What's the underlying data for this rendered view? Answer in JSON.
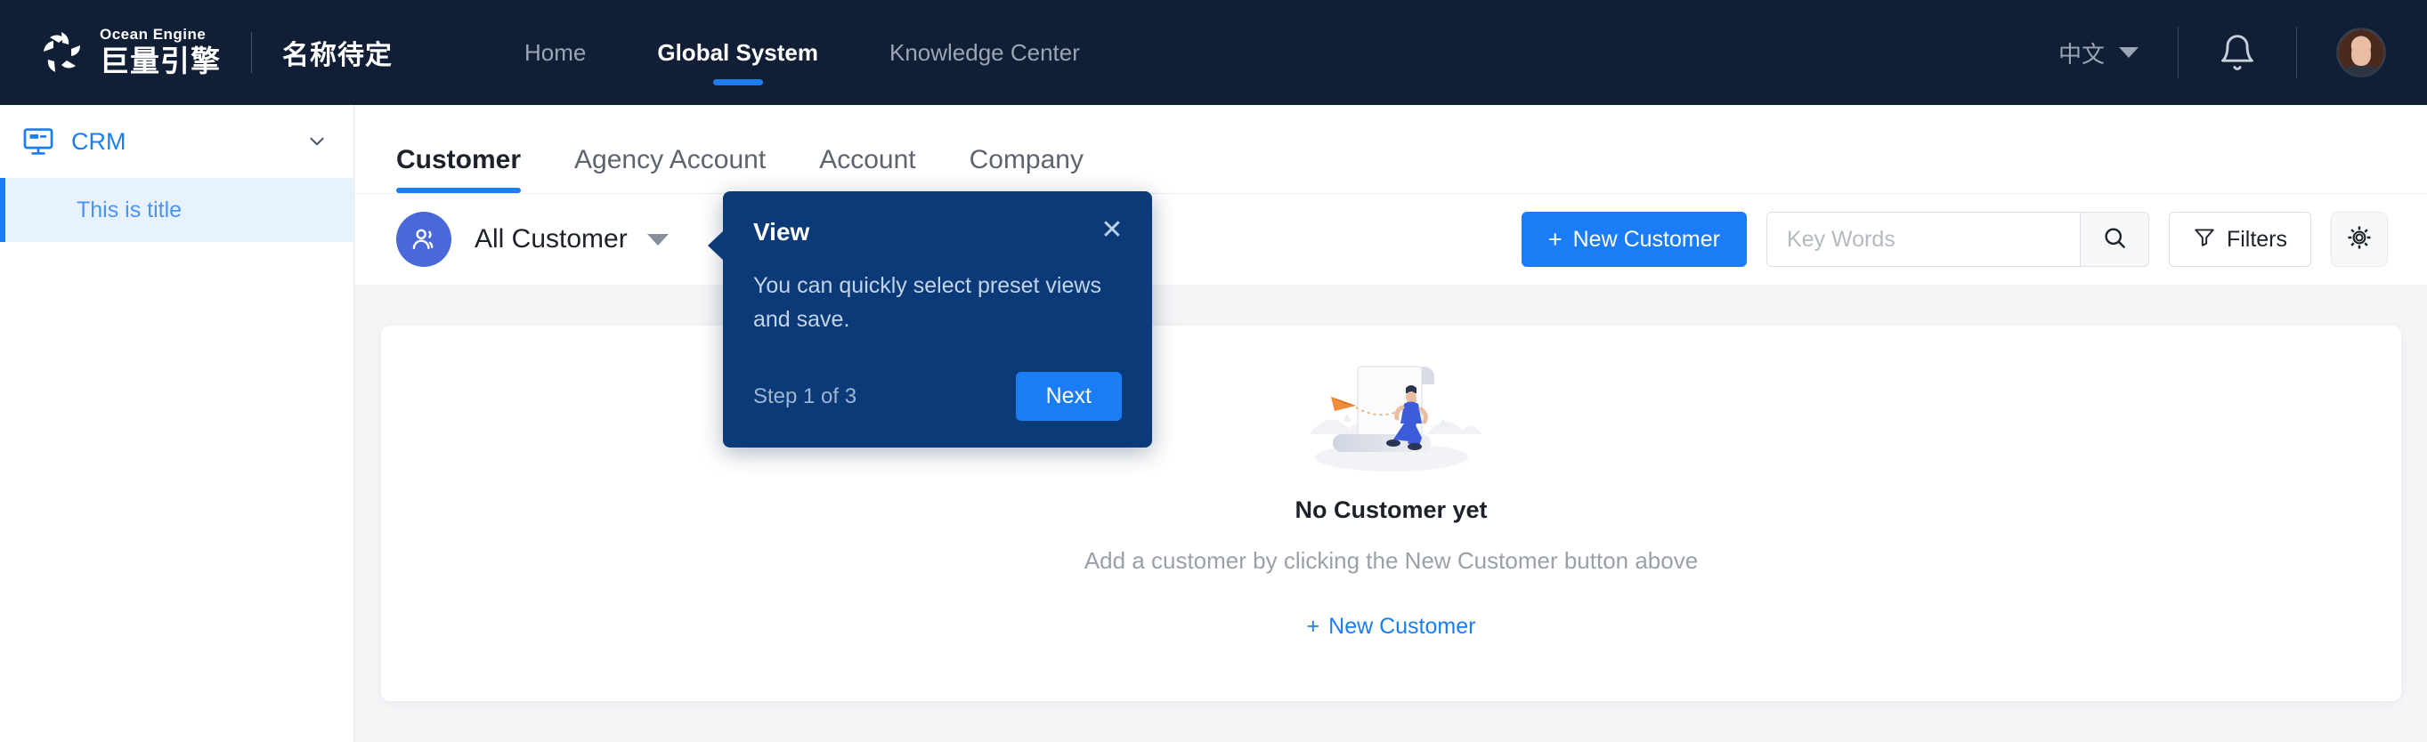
{
  "header": {
    "logo_en": "Ocean Engine",
    "logo_cn": "巨量引擎",
    "brand_sub": "名称待定",
    "nav": [
      {
        "label": "Home",
        "active": false
      },
      {
        "label": "Global System",
        "active": true
      },
      {
        "label": "Knowledge Center",
        "active": false
      }
    ],
    "language": "中文",
    "icons": {
      "bell": "bell-icon",
      "avatar": "user-avatar",
      "caret": "chevron-down-icon"
    }
  },
  "sidebar": {
    "group_label": "CRM",
    "group_icon": "monitor-icon",
    "collapse_icon": "chevron-down-icon",
    "items": [
      {
        "label": "This is title",
        "active": true
      }
    ]
  },
  "tabs": [
    {
      "label": "Customer",
      "active": true
    },
    {
      "label": "Agency Account",
      "active": false
    },
    {
      "label": "Account",
      "active": false
    },
    {
      "label": "Company",
      "active": false
    }
  ],
  "toolbar": {
    "view_name": "All Customer",
    "view_icon": "users-icon",
    "view_caret": "caret-down-icon",
    "new_customer_label": "New Customer",
    "new_customer_plus": "+",
    "search_placeholder": "Key Words",
    "search_value": "",
    "search_icon": "search-icon",
    "filters_label": "Filters",
    "filters_icon": "funnel-icon",
    "settings_icon": "gear-icon"
  },
  "empty_state": {
    "title": "No Customer yet",
    "description": "Add a customer by clicking the New Customer button above",
    "link_label": "New Customer",
    "link_plus": "+",
    "illustration": "empty-document-person-illustration"
  },
  "tooltip": {
    "title": "View",
    "body": "You can quickly select preset views and save.",
    "step": "Step 1 of 3",
    "next_label": "Next",
    "close_icon": "close-icon"
  },
  "colors": {
    "header_bg": "#101f35",
    "accent": "#1a7df5",
    "tooltip_bg": "#0a3a78",
    "page_bg": "#f4f5f7",
    "sidebar_active_bg": "#e8f2fe",
    "view_avatar_bg": "#4a68d8"
  }
}
